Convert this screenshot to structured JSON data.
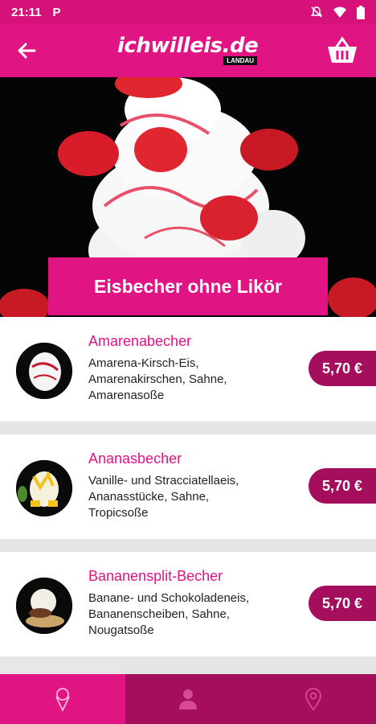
{
  "status_bar": {
    "time": "21:11",
    "app_icon_letter": "P"
  },
  "header": {
    "logo_text": "ichwilleis.de",
    "logo_sub": "LANDAU",
    "back_icon": "arrow-left-icon",
    "cart_icon": "basket-icon"
  },
  "hero": {
    "title": "Eisbecher ohne Likör"
  },
  "items": [
    {
      "name": "Amarenabecher",
      "description": "Amarena-Kirsch-Eis,\nAmarenakirschen, Sahne,\nAmarenasoße",
      "price": "5,70 €"
    },
    {
      "name": "Ananasbecher",
      "description": "Vanille- und Stracciatellaeis,\nAnanasstücke, Sahne,\nTropicsoße",
      "price": "5,70 €"
    },
    {
      "name": "Bananensplit-Becher",
      "description": "Banane- und Schokoladeneis,\nBananenscheiben, Sahne,\nNougatsoße",
      "price": "5,70 €"
    }
  ],
  "bottom_nav": [
    {
      "icon": "ice-cream-icon",
      "active": true
    },
    {
      "icon": "person-icon",
      "active": false
    },
    {
      "icon": "location-pin-icon",
      "active": false
    }
  ],
  "colors": {
    "primary": "#e01483",
    "primary_dark": "#a50e5c",
    "statusbar": "#d6127a"
  }
}
